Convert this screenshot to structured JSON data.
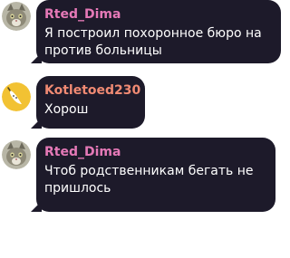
{
  "messages": [
    {
      "author": "Rted_Dima",
      "text": "Я построил похоронное бюро на против больницы",
      "name_color": "#e579b7",
      "avatar": "cat-avatar"
    },
    {
      "author": "Kotletoed230",
      "text": "Хорош",
      "name_color": "#f08a73",
      "avatar": "banana-avatar"
    },
    {
      "author": "Rted_Dima",
      "text": "Чтоб родственникам бегать не пришлось",
      "name_color": "#e579b7",
      "avatar": "cat-avatar"
    }
  ]
}
